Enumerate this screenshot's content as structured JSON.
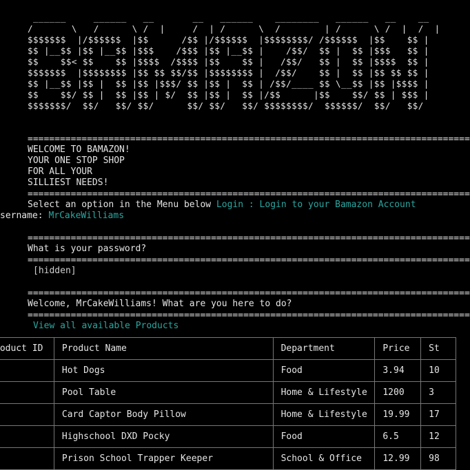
{
  "ascii_logo": [
    " ______     ______   __       __   ______    ________   ______   __    __",
    "/       \\   /      \\ /  |     /  | /      \\  /        | /      \\ /  |  /  |",
    "$$$$$$$  |/$$$$$$  |$$      /$$ |/$$$$$$  |$$$$$$$$/ /$$$$$$  |$$    $$ |",
    "$$ |__$$ |$$ |__$$ |$$$    /$$$ |$$ |__$$ |    /$$/  $$ |  $$ |$$$   $$ |",
    "$$    $$< $$    $$ |$$$$  /$$$$ |$$    $$ |   /$$/   $$ |  $$ |$$$$  $$ |",
    "$$$$$$$  |$$$$$$$$ |$$ $$ $$/$$ |$$$$$$$$ |  /$$/    $$ |  $$ |$$ $$ $$ |",
    "$$ |__$$ |$$ |  $$ |$$ |$$$/ $$ |$$ |  $$ | /$$/____ $$ \\__$$ |$$ |$$$$ |",
    "$$    $$/ $$ |  $$ |$$ | $/  $$ |$$ |  $$ |/$$      |$$    $$/ $$ | $$$ |",
    "$$$$$$$/  $$/   $$/ $$/      $$/ $$/   $$/ $$$$$$$$/  $$$$$$/  $$/   $$/"
  ],
  "separator": "====================================================================================",
  "welcome_lines": [
    "WELCOME TO BAMAZON!",
    "YOUR ONE STOP SHOP",
    "FOR ALL YOUR",
    "SILLIEST NEEDS!"
  ],
  "menu_prompt": "Select an option in the Menu below",
  "menu_selection": "Login : Login to your Bamazon Account",
  "username_label": "sername:",
  "username_value": "MrCakeWilliams",
  "password_prompt": "What is your password?",
  "password_value": "[hidden]",
  "welcome_user": "Welcome, MrCakeWilliams! What are you here to do?",
  "action_selection": "View all available Products",
  "table": {
    "headers": [
      "roduct ID",
      "Product Name",
      "Department",
      "Price",
      "St"
    ],
    "rows": [
      [
        "",
        "Hot Dogs",
        "Food",
        "3.94",
        "10"
      ],
      [
        "",
        "Pool Table",
        "Home & Lifestyle",
        "1200",
        "3"
      ],
      [
        "",
        "Card Captor Body Pillow",
        "Home & Lifestyle",
        "19.99",
        "17"
      ],
      [
        "",
        "Highschool DXD Pocky",
        "Food",
        "6.5",
        "12"
      ],
      [
        "",
        "Prison School Trapper Keeper",
        "School & Office",
        "12.99",
        "98"
      ]
    ]
  }
}
